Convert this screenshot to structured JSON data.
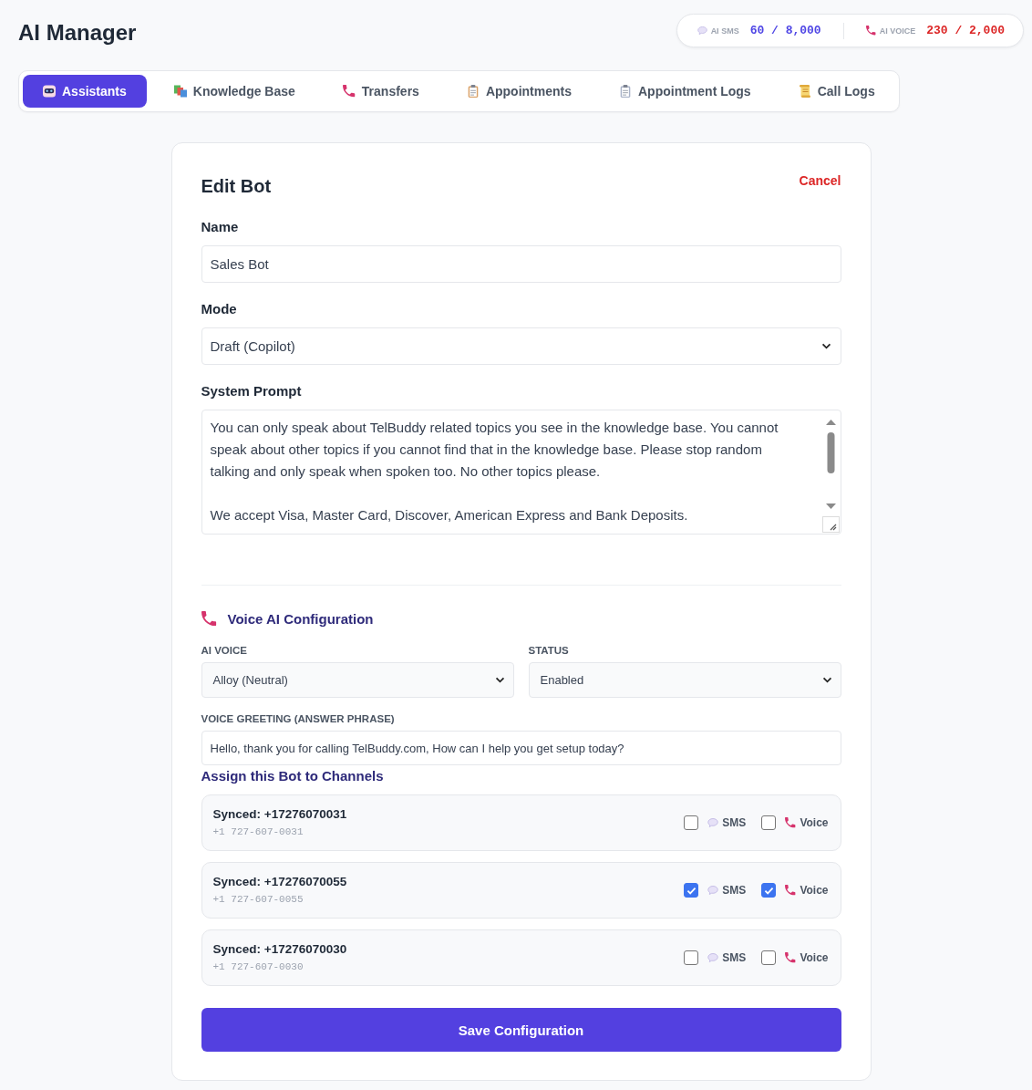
{
  "header": {
    "title": "AI Manager",
    "usage": [
      {
        "kind": "sms",
        "label": "AI SMS",
        "value": "60 / 8,000",
        "color": "#4f46e5"
      },
      {
        "kind": "voice",
        "label": "AI VOICE",
        "value": "230 / 2,000",
        "color": "#dc2626"
      }
    ]
  },
  "tabs": [
    {
      "label": "Assistants",
      "selected": true
    },
    {
      "label": "Knowledge Base",
      "selected": false
    },
    {
      "label": "Transfers",
      "selected": false
    },
    {
      "label": "Appointments",
      "selected": false
    },
    {
      "label": "Appointment Logs",
      "selected": false
    },
    {
      "label": "Call Logs",
      "selected": false
    }
  ],
  "form": {
    "title": "Edit Bot",
    "cancel": "Cancel",
    "fields": [
      {
        "kind": "input",
        "label": "Name",
        "value": "Sales Bot"
      },
      {
        "kind": "select",
        "label": "Mode",
        "value": "Draft (Copilot)"
      },
      {
        "kind": "textarea",
        "label": "System Prompt",
        "value": "You can only speak about TelBuddy related topics you see in the knowledge base. You cannot speak about other topics if you cannot find that in the knowledge base. Please stop random talking and only speak when spoken too. No other topics please.\n\nWe accept Visa, Master Card, Discover, American Express and Bank Deposits."
      }
    ]
  },
  "voice": {
    "title": "Voice AI Configuration",
    "selects": [
      {
        "label": "AI VOICE",
        "value": "Alloy (Neutral)"
      },
      {
        "label": "STATUS",
        "value": "Enabled"
      }
    ],
    "greeting": {
      "label": "VOICE GREETING (ANSWER PHRASE)",
      "value": "Hello, thank you for calling TelBuddy.com, How can I help you get setup today?"
    }
  },
  "channels": {
    "title": "Assign this Bot to Channels",
    "items": [
      {
        "name": "Synced: +17276070031",
        "number": "+1 727-607-0031",
        "options": [
          {
            "kind": "sms",
            "label": "SMS",
            "checked": false
          },
          {
            "kind": "voice",
            "label": "Voice",
            "checked": false
          }
        ]
      },
      {
        "name": "Synced: +17276070055",
        "number": "+1 727-607-0055",
        "options": [
          {
            "kind": "sms",
            "label": "SMS",
            "checked": true
          },
          {
            "kind": "voice",
            "label": "Voice",
            "checked": true
          }
        ]
      },
      {
        "name": "Synced: +17276070030",
        "number": "+1 727-607-0030",
        "options": [
          {
            "kind": "sms",
            "label": "SMS",
            "checked": false
          },
          {
            "kind": "voice",
            "label": "Voice",
            "checked": false
          }
        ]
      }
    ]
  },
  "save_button": "Save Configuration"
}
